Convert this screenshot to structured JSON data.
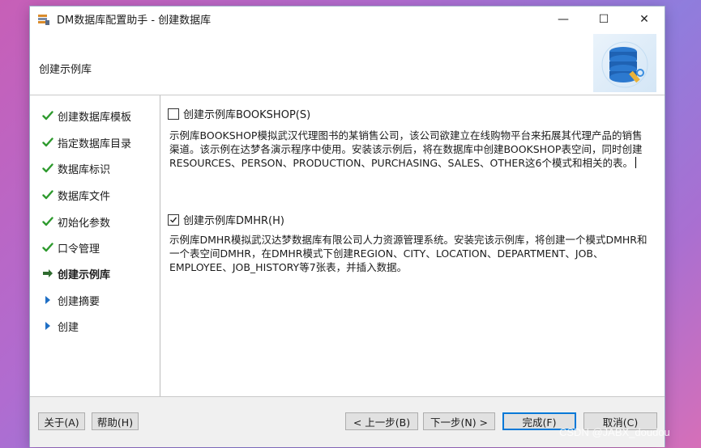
{
  "window": {
    "title": "DM数据库配置助手 - 创建数据库",
    "controls": {
      "minimize": "—",
      "maximize": "☐",
      "close": "✕"
    }
  },
  "header": {
    "title": "创建示例库"
  },
  "steps": [
    {
      "label": "创建数据库模板",
      "state": "done"
    },
    {
      "label": "指定数据库目录",
      "state": "done"
    },
    {
      "label": "数据库标识",
      "state": "done"
    },
    {
      "label": "数据库文件",
      "state": "done"
    },
    {
      "label": "初始化参数",
      "state": "done"
    },
    {
      "label": "口令管理",
      "state": "done"
    },
    {
      "label": "创建示例库",
      "state": "current"
    },
    {
      "label": "创建摘要",
      "state": "pending"
    },
    {
      "label": "创建",
      "state": "pending"
    }
  ],
  "options": {
    "bookshop": {
      "label": "创建示例库BOOKSHOP(S)",
      "checked": false,
      "description": "示例库BOOKSHOP模拟武汉代理图书的某销售公司，该公司欲建立在线购物平台来拓展其代理产品的销售渠道。该示例在达梦各演示程序中使用。安装该示例后，将在数据库中创建BOOKSHOP表空间，同时创建RESOURCES、PERSON、PRODUCTION、PURCHASING、SALES、OTHER这6个模式和相关的表。"
    },
    "dmhr": {
      "label": "创建示例库DMHR(H)",
      "checked": true,
      "description": "示例库DMHR模拟武汉达梦数据库有限公司人力资源管理系统。安装完该示例库，将创建一个模式DMHR和一个表空间DMHR，在DMHR模式下创建REGION、CITY、LOCATION、DEPARTMENT、JOB、EMPLOYEE、JOB_HISTORY等7张表，并插入数据。"
    }
  },
  "footer": {
    "about": "关于(A)",
    "help": "帮助(H)",
    "prev": "< 上一步(B)",
    "next": "下一步(N) >",
    "finish": "完成(F)",
    "cancel": "取消(C)"
  },
  "watermark": "CSDN @JABX_doudou",
  "colors": {
    "check_green": "#2e9a2e",
    "arrow_blue": "#1f6fc5",
    "accent": "#0078d7"
  }
}
